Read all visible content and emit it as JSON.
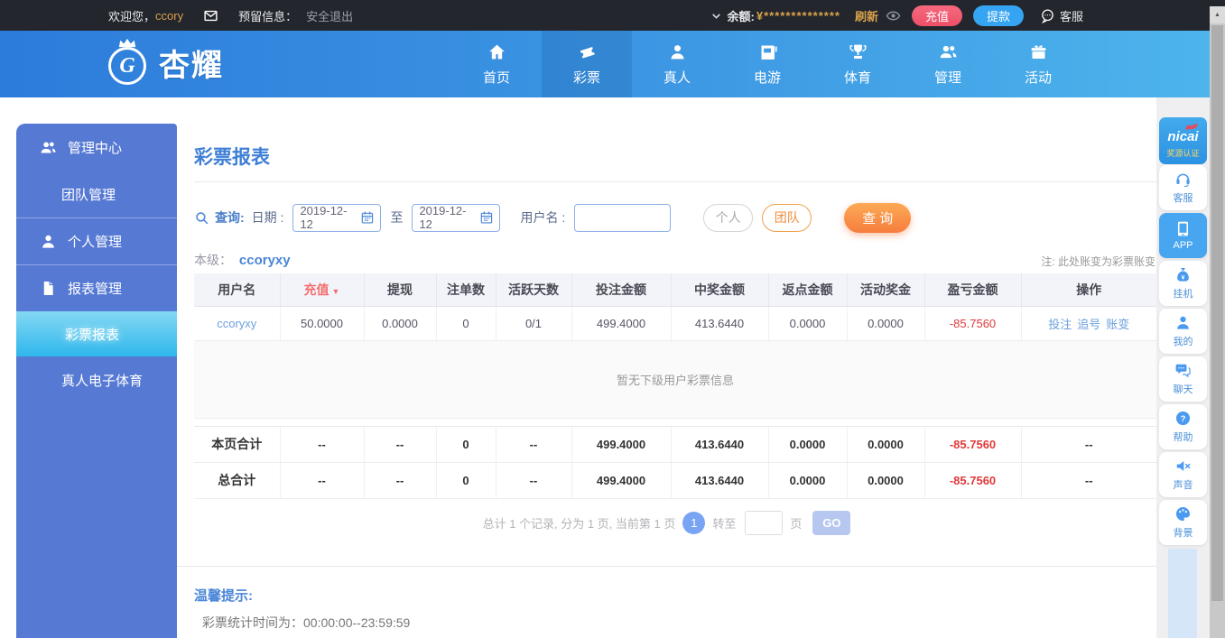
{
  "topbar": {
    "welcome_label": "欢迎您，",
    "username": "ccory",
    "reserved_label": "预留信息：",
    "logout": "安全退出",
    "balance_label": "余额:",
    "balance_currency": "¥",
    "balance_value": "**************",
    "refresh": "刷新",
    "recharge_btn": "充值",
    "withdraw_btn": "提款",
    "service": "客服"
  },
  "nav": {
    "logo_text": "杏耀",
    "logo_initial": "G",
    "items": [
      "首页",
      "彩票",
      "真人",
      "电游",
      "体育",
      "管理",
      "活动"
    ]
  },
  "sidebar": {
    "items": [
      "管理中心",
      "团队管理",
      "个人管理",
      "报表管理",
      "彩票报表",
      "真人电子体育"
    ]
  },
  "main": {
    "title": "彩票报表",
    "query": {
      "search_label": "查询:",
      "date_label": "日期 :",
      "date_from": "2019-12-12",
      "to_label": "至",
      "date_to": "2019-12-12",
      "username_label": "用户名 :",
      "username_value": "",
      "personal_btn": "个人",
      "team_btn": "团队",
      "search_btn": "查 询"
    },
    "level_label": "本级：",
    "level_value": "ccoryxy",
    "note": "注: 此处账变为彩票账变",
    "table": {
      "headers": [
        "用户名",
        "充值",
        "提现",
        "注单数",
        "活跃天数",
        "投注金额",
        "中奖金额",
        "返点金额",
        "活动奖金",
        "盈亏金额",
        "操作"
      ],
      "sort_arrow": "▼",
      "row": {
        "username": "ccoryxy",
        "cells": [
          "50.0000",
          "0.0000",
          "0",
          "0/1",
          "499.4000",
          "413.6440",
          "0.0000",
          "0.0000",
          "-85.7560"
        ],
        "actions": [
          "投注",
          "追号",
          "账变"
        ]
      },
      "empty_message": "暂无下级用户彩票信息",
      "page_total": {
        "label": "本页合计",
        "cells": [
          "--",
          "--",
          "0",
          "--",
          "499.4000",
          "413.6440",
          "0.0000",
          "0.0000",
          "-85.7560",
          "--"
        ]
      },
      "grand_total": {
        "label": "总合计",
        "cells": [
          "--",
          "--",
          "0",
          "--",
          "499.4000",
          "413.6440",
          "0.0000",
          "0.0000",
          "-85.7560",
          "--"
        ]
      }
    },
    "pagination": {
      "summary": "总计 1 个记录, 分为 1 页, 当前第 1 页",
      "current_page": "1",
      "goto_label": "转至",
      "page_unit": "页",
      "goto_value": "",
      "go_btn": "GO"
    },
    "tips": {
      "title": "温馨提示:",
      "line": "彩票统计时间为：00:00:00--23:59:59"
    }
  },
  "widgets": {
    "badge_brand": "nicai",
    "badge_cert": "奖源认证",
    "items": [
      "客服",
      "APP",
      "挂机",
      "我的",
      "聊天",
      "帮助",
      "声音",
      "背景"
    ]
  },
  "colors": {
    "accent_blue": "#3d97e3",
    "sidebar_blue": "#5679d3",
    "active_cyan": "#2fb7ec",
    "gold": "#d9a24d",
    "negative_red": "#e03a3a",
    "orange_btn": "#f67d3e"
  }
}
